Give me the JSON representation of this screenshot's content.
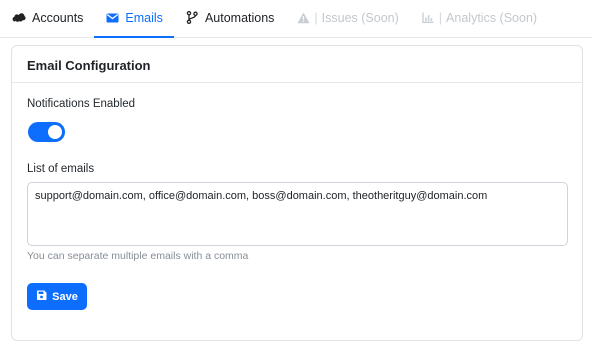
{
  "tabs": [
    {
      "label": "Accounts",
      "icon": "salesforce-cloud-icon",
      "state": "normal"
    },
    {
      "label": "Emails",
      "icon": "envelope-icon",
      "state": "active"
    },
    {
      "label": "Automations",
      "icon": "branch-icon",
      "state": "normal"
    },
    {
      "label": "Issues (Soon)",
      "icon": "warning-icon",
      "state": "disabled"
    },
    {
      "label": "Analytics (Soon)",
      "icon": "chart-icon",
      "state": "disabled"
    }
  ],
  "card": {
    "title": "Email Configuration",
    "notifications_label": "Notifications Enabled",
    "notifications_enabled": true,
    "list_label": "List of emails",
    "emails_value": "support@domain.com, office@domain.com, boss@domain.com, theotheritguy@domain.com",
    "help_text": "You can separate multiple emails with a comma",
    "save_label": "Save"
  },
  "colors": {
    "accent": "#0d6efd",
    "disabled_text": "#c3c8cd",
    "border": "#dfe3e7"
  }
}
